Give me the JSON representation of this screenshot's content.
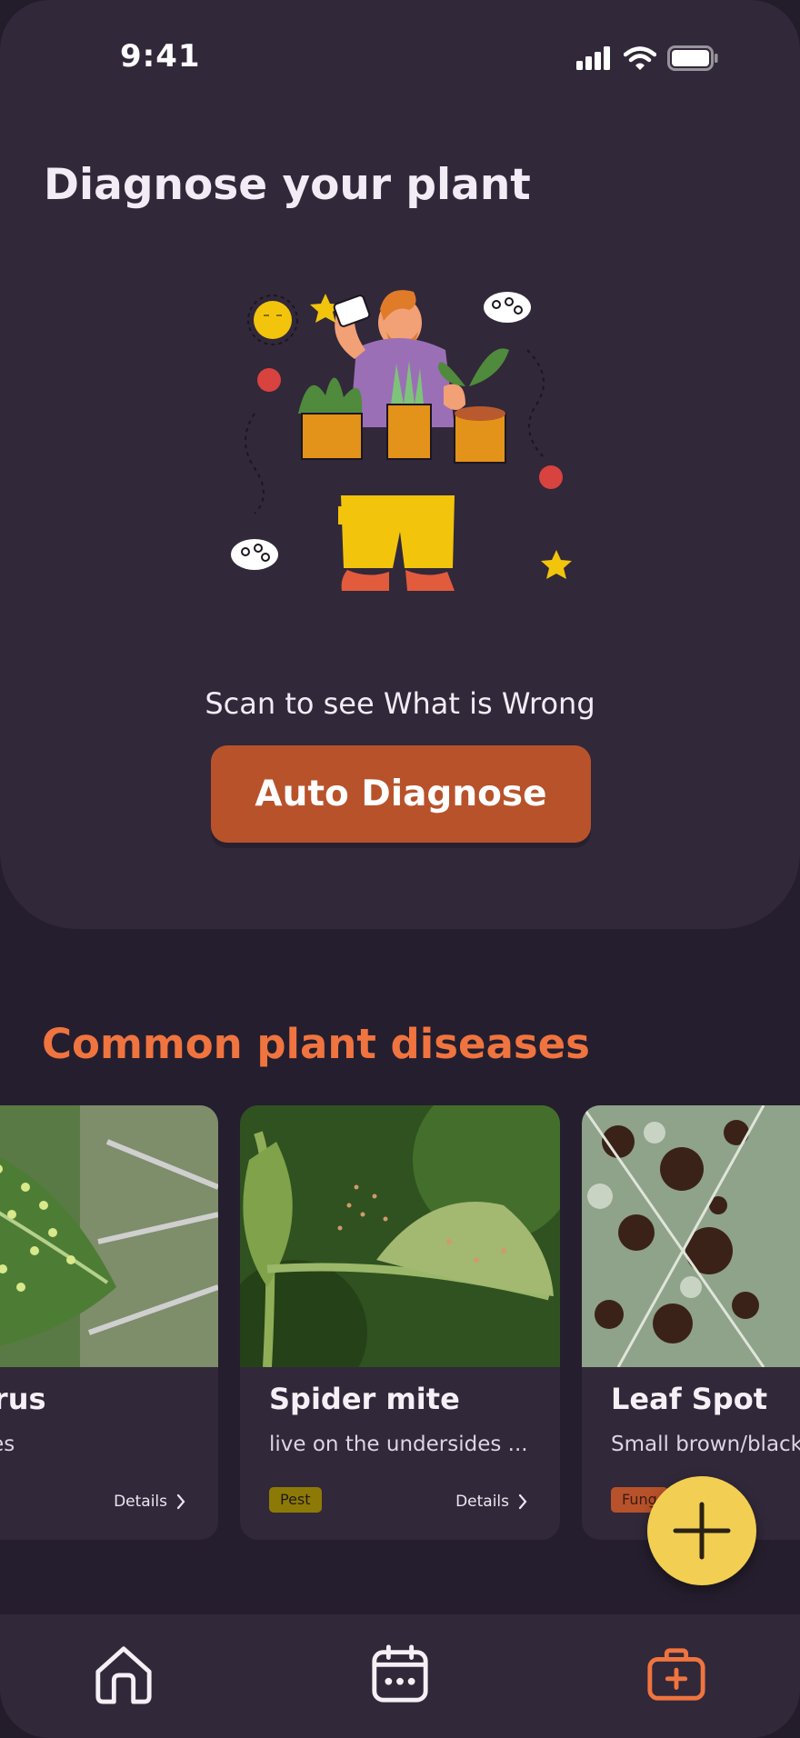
{
  "status_bar": {
    "time": "9:41"
  },
  "header": {
    "title": "Diagnose your plant"
  },
  "hero": {
    "scan_text": "Scan to see What is Wrong",
    "button_label": "Auto Diagnose"
  },
  "section": {
    "title": "Common plant diseases"
  },
  "cards": [
    {
      "title": "ic virus",
      "description": "d leaves",
      "details_label": "Details"
    },
    {
      "title": "Spider mite",
      "description": "live on the undersides ...",
      "tag": "Pest",
      "details_label": "Details"
    },
    {
      "title": "Leaf Spot",
      "description": "Small brown/black",
      "tag": "Fung"
    }
  ],
  "colors": {
    "accent": "#b8522b",
    "section_title": "#f0743f",
    "fab": "#f2cf52",
    "active_nav": "#f0743f"
  },
  "nav": [
    {
      "icon": "home-icon"
    },
    {
      "icon": "calendar-icon"
    },
    {
      "icon": "first-aid-kit-icon",
      "active": true
    }
  ]
}
